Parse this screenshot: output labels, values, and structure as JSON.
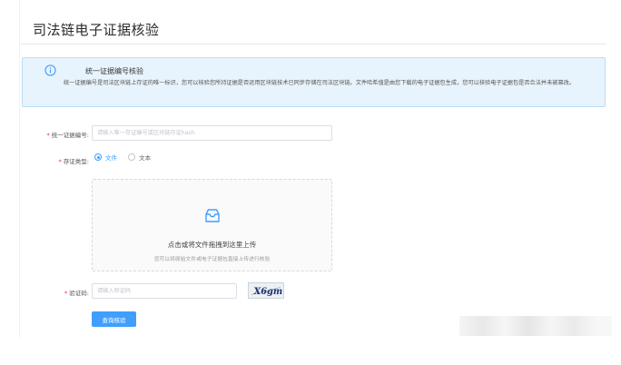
{
  "page": {
    "title": "司法链电子证据核验"
  },
  "info": {
    "title": "统一证据编号核验",
    "description": "统一证据编号是司法区块链上存证的唯一标识，您可以核验您所持证据是否运用区块链技术已同步存储在司法区块链。文件哈希值是由您下载的电子证据包生成，您可以核验电子证据包是否合法并未被篡改。",
    "icon": "info-circle-icon",
    "accent_color": "#409eff",
    "background_color": "#e8f4fd"
  },
  "form": {
    "evidence_id": {
      "required_mark": "*",
      "label": "统一证据编号:",
      "value": "",
      "placeholder": "请输入唯一存证编号或区块链存证hash"
    },
    "storage_type": {
      "required_mark": "*",
      "label": "存证类型:",
      "options": [
        {
          "label": "文件",
          "checked": true
        },
        {
          "label": "文本",
          "checked": false
        }
      ]
    },
    "upload": {
      "icon": "inbox-icon",
      "text": "点击或将文件拖拽到这里上传",
      "hint": "您可以将原始文件或电子证据包直接上传进行核验"
    },
    "captcha": {
      "required_mark": "*",
      "label": "验证码:",
      "value": "",
      "placeholder": "请输入验证码",
      "image_text": "X6gm"
    },
    "submit": {
      "label": "查询核验",
      "color": "#409eff"
    }
  }
}
